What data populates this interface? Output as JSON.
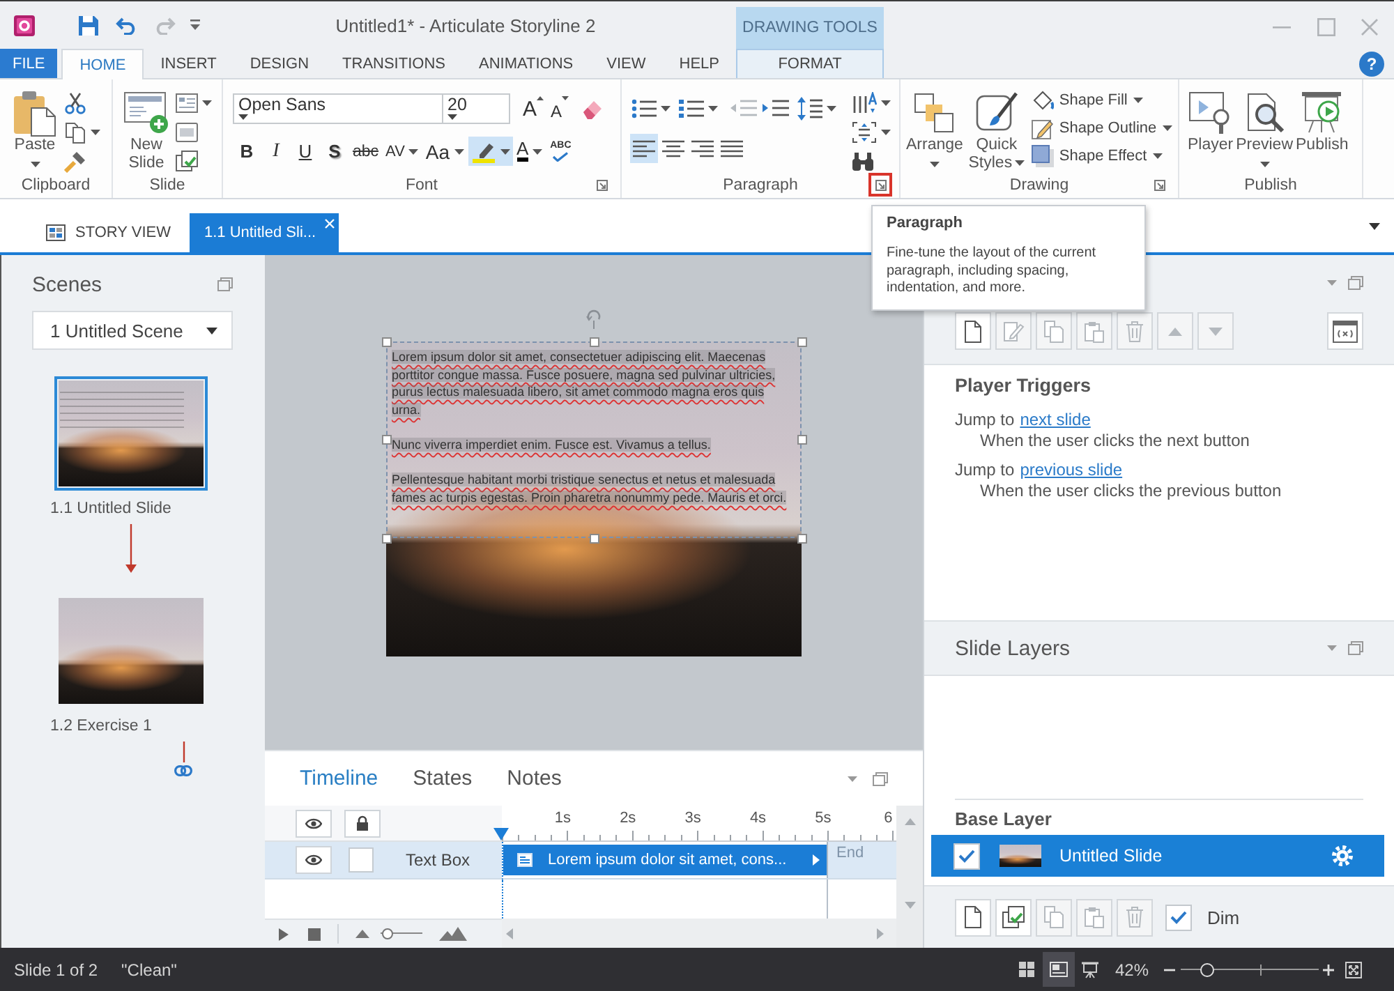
{
  "window": {
    "title": "Untitled1* - Articulate Storyline 2",
    "contextual_group": "DRAWING TOOLS"
  },
  "ribbon": {
    "tabs": [
      {
        "label": "FILE",
        "kind": "file",
        "selected": false
      },
      {
        "label": "HOME",
        "kind": "tab",
        "selected": true
      },
      {
        "label": "INSERT",
        "kind": "tab",
        "selected": false
      },
      {
        "label": "DESIGN",
        "kind": "tab",
        "selected": false
      },
      {
        "label": "TRANSITIONS",
        "kind": "tab",
        "selected": false
      },
      {
        "label": "ANIMATIONS",
        "kind": "tab",
        "selected": false
      },
      {
        "label": "VIEW",
        "kind": "tab",
        "selected": false
      },
      {
        "label": "HELP",
        "kind": "tab",
        "selected": false
      },
      {
        "label": "FORMAT",
        "kind": "contextual",
        "selected": false
      }
    ],
    "help": "?",
    "clipboard": {
      "label": "Clipboard",
      "paste": "Paste"
    },
    "slide": {
      "label": "Slide",
      "new_slide": "New Slide"
    },
    "font": {
      "label": "Font",
      "font_name": "Open Sans",
      "font_size": "20",
      "size_buttons": [
        {
          "label": "A",
          "kind": "grow"
        },
        {
          "label": "A",
          "kind": "shrink"
        }
      ],
      "format_buttons": [
        {
          "label": "B",
          "kind": "bold",
          "selected": false
        },
        {
          "label": "I",
          "kind": "italic",
          "selected": false
        },
        {
          "label": "U",
          "kind": "underline",
          "selected": false
        },
        {
          "label": "S",
          "kind": "shadow",
          "selected": false
        },
        {
          "label": "abc",
          "kind": "strikethrough",
          "selected": false
        },
        {
          "label": "AV",
          "kind": "spacing",
          "selected": false
        },
        {
          "label": "Aa",
          "kind": "case",
          "selected": false
        },
        {
          "kind": "highlight",
          "selected": true
        },
        {
          "label": "A",
          "kind": "font_color",
          "selected": false
        },
        {
          "label": "ABC",
          "kind": "spelling",
          "selected": false
        }
      ]
    },
    "paragraph": {
      "label": "Paragraph",
      "tools": [
        {
          "kind": "bullets",
          "disabled": false
        },
        {
          "kind": "numbering",
          "disabled": false
        },
        {
          "kind": "decrease_indent",
          "disabled": true
        },
        {
          "kind": "increase_indent",
          "disabled": false
        },
        {
          "kind": "line_spacing",
          "disabled": false
        }
      ],
      "alignment": [
        {
          "kind": "left",
          "selected": true
        },
        {
          "kind": "center",
          "selected": false
        },
        {
          "kind": "right",
          "selected": false
        },
        {
          "kind": "justify",
          "selected": false
        }
      ],
      "launcher_highlighted": true
    },
    "drawing": {
      "label": "Drawing",
      "arrange": "Arrange",
      "quick_styles": "Quick Styles",
      "shape_menus": [
        {
          "label": "Shape Fill",
          "kind": "fill"
        },
        {
          "label": "Shape Outline",
          "kind": "outline"
        },
        {
          "label": "Shape Effect",
          "kind": "effect"
        }
      ]
    },
    "publish": {
      "label": "Publish",
      "buttons": [
        {
          "label": "Player",
          "kind": "player"
        },
        {
          "label": "Preview",
          "kind": "preview"
        },
        {
          "label": "Publish",
          "kind": "publish"
        }
      ]
    }
  },
  "document_tabs": [
    {
      "label": "STORY VIEW",
      "kind": "story",
      "selected": false
    },
    {
      "label": "1.1 Untitled Sli...",
      "kind": "slide",
      "selected": true
    }
  ],
  "scenes_panel": {
    "title": "Scenes",
    "scene": "1 Untitled Scene",
    "slides": [
      {
        "label": "1.1 Untitled Slide",
        "selected": true,
        "has_text": true,
        "connector": {
          "kind": "arrow"
        }
      },
      {
        "label": "1.2 Exercise 1",
        "selected": false,
        "has_text": false,
        "connector": {
          "kind": "link"
        }
      }
    ]
  },
  "stage": {
    "text_box": {
      "selected": true,
      "spelling_marks": true,
      "paragraphs": [
        "Lorem ipsum dolor sit amet, consectetuer adipiscing elit. Maecenas porttitor congue massa. Fusce posuere, magna sed pulvinar ultricies, purus lectus malesuada libero, sit amet commodo magna eros quis urna.",
        "Nunc viverra imperdiet enim. Fusce est. Vivamus a tellus.",
        "Pellentesque habitant morbi tristique senectus et netus et malesuada fames ac turpis egestas. Proin pharetra nonummy pede. Mauris et orci."
      ]
    }
  },
  "tooltip": {
    "title": "Paragraph",
    "text": "Fine-tune the layout of the current paragraph, including spacing, indentation, and more."
  },
  "timeline": {
    "tabs": [
      {
        "label": "Timeline",
        "selected": true
      },
      {
        "label": "States",
        "selected": false
      },
      {
        "label": "Notes",
        "selected": false
      }
    ],
    "ticks": [
      "1s",
      "2s",
      "3s",
      "4s",
      "5s",
      "6"
    ],
    "rows": [
      {
        "name": "Text Box",
        "visible": true,
        "locked": false,
        "selected": true,
        "bar_label": "Lorem ipsum dolor sit amet, cons..."
      }
    ],
    "end_label": "End",
    "zoom_slider": {
      "level": 0.15
    }
  },
  "triggers_panel": {
    "toolbar": [
      {
        "kind": "new",
        "disabled": false
      },
      {
        "kind": "edit",
        "disabled": true
      },
      {
        "kind": "copy",
        "disabled": true
      },
      {
        "kind": "paste",
        "disabled": true
      },
      {
        "kind": "delete",
        "disabled": true
      },
      {
        "kind": "up",
        "disabled": true
      },
      {
        "kind": "down",
        "disabled": true
      }
    ],
    "heading": "Player Triggers",
    "triggers": [
      {
        "action": "Jump to",
        "target": "next slide",
        "condition": "When the user clicks the next button"
      },
      {
        "action": "Jump to",
        "target": "previous slide",
        "condition": "When the user clicks the previous button"
      }
    ]
  },
  "layers_panel": {
    "title": "Slide Layers",
    "base_label": "Base Layer",
    "layers": [
      {
        "name": "Untitled Slide",
        "visible": true,
        "selected": true
      }
    ],
    "toolbar": [
      {
        "kind": "new",
        "disabled": false
      },
      {
        "kind": "duplicate",
        "disabled": false
      },
      {
        "kind": "copy",
        "disabled": true
      },
      {
        "kind": "paste",
        "disabled": true
      },
      {
        "kind": "delete",
        "disabled": true
      }
    ],
    "dim": {
      "label": "Dim",
      "checked": true
    }
  },
  "status_bar": {
    "slide_info": "Slide 1 of 2",
    "state": "\"Clean\"",
    "views": [
      {
        "kind": "story",
        "selected": false
      },
      {
        "kind": "slide",
        "selected": true
      },
      {
        "kind": "preview",
        "selected": false
      }
    ],
    "zoom": "42%",
    "zoom_slider": {
      "level": 0.19
    }
  }
}
